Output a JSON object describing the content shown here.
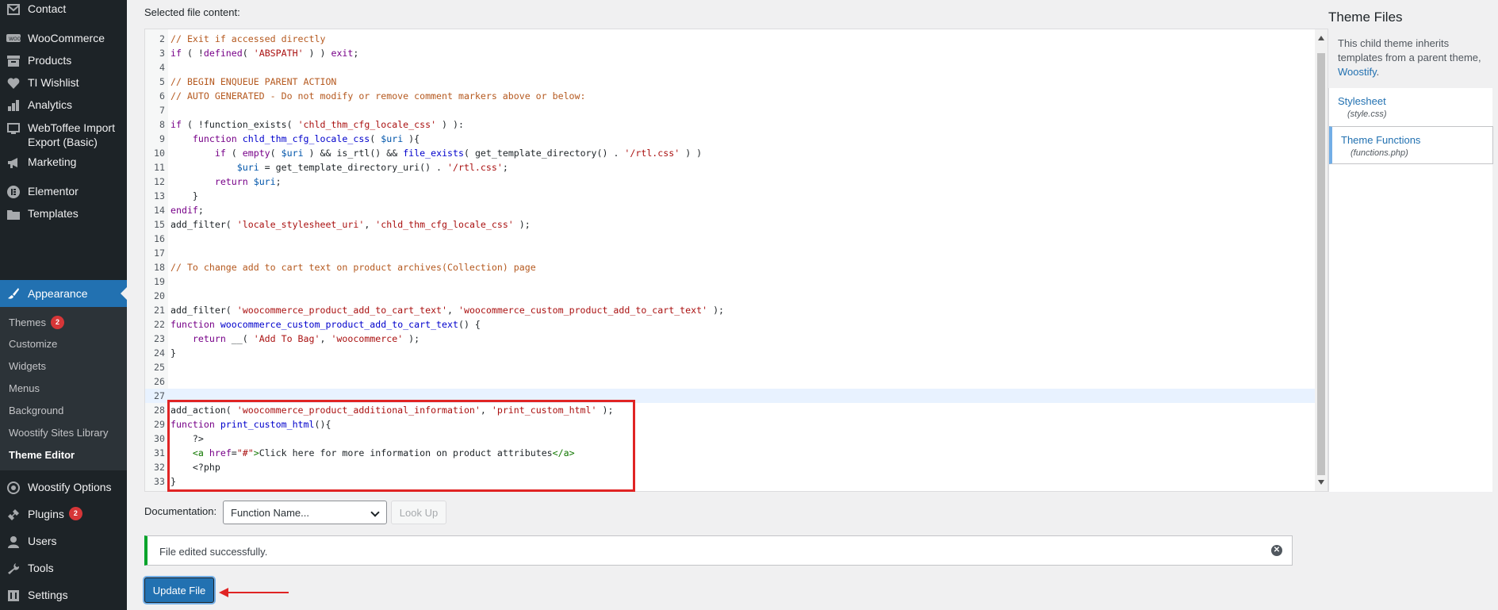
{
  "sidebar": {
    "menu": [
      {
        "label": "Contact",
        "icon": "mail-icon"
      },
      {
        "label": "WooCommerce",
        "icon": "woocommerce-icon"
      },
      {
        "label": "Products",
        "icon": "archive-icon"
      },
      {
        "label": "TI Wishlist",
        "icon": "heart-icon"
      },
      {
        "label": "Analytics",
        "icon": "bar-chart-icon"
      },
      {
        "label": "WebToffee Import Export (Basic)",
        "icon": "import-export-icon"
      },
      {
        "label": "Marketing",
        "icon": "megaphone-icon"
      },
      {
        "label": "Elementor",
        "icon": "elementor-icon"
      },
      {
        "label": "Templates",
        "icon": "folder-icon"
      },
      {
        "label": "Appearance",
        "icon": "paintbrush-icon"
      },
      {
        "label": "Woostify Options",
        "icon": "woostify-icon"
      },
      {
        "label": "Plugins",
        "icon": "plug-icon",
        "badge": "2"
      },
      {
        "label": "Users",
        "icon": "user-icon"
      },
      {
        "label": "Tools",
        "icon": "wrench-icon"
      },
      {
        "label": "Settings",
        "icon": "settings-icon"
      }
    ],
    "submenu": [
      {
        "label": "Themes",
        "badge": "2"
      },
      {
        "label": "Customize"
      },
      {
        "label": "Widgets"
      },
      {
        "label": "Menus"
      },
      {
        "label": "Background"
      },
      {
        "label": "Woostify Sites Library"
      },
      {
        "label": "Theme Editor"
      }
    ]
  },
  "editor": {
    "label": "Selected file content:",
    "lines": [
      {
        "n": "2",
        "tokens": [
          [
            "cm",
            "// Exit if accessed directly"
          ]
        ]
      },
      {
        "n": "3",
        "tokens": [
          [
            "kw",
            "if"
          ],
          [
            "",
            " ( !"
          ],
          [
            "kw",
            "defined"
          ],
          [
            "",
            "( "
          ],
          [
            "st",
            "'ABSPATH'"
          ],
          [
            "",
            " ) ) "
          ],
          [
            "kw",
            "exit"
          ],
          [
            "",
            ";"
          ]
        ]
      },
      {
        "n": "4",
        "tokens": []
      },
      {
        "n": "5",
        "tokens": [
          [
            "cm",
            "// BEGIN ENQUEUE PARENT ACTION"
          ]
        ]
      },
      {
        "n": "6",
        "tokens": [
          [
            "cm",
            "// AUTO GENERATED - Do not modify or remove comment markers above or below:"
          ]
        ]
      },
      {
        "n": "7",
        "tokens": []
      },
      {
        "n": "8",
        "tokens": [
          [
            "kw",
            "if"
          ],
          [
            "",
            " ( !function_exists( "
          ],
          [
            "st",
            "'chld_thm_cfg_locale_css'"
          ],
          [
            "",
            " ) ):"
          ]
        ]
      },
      {
        "n": "9",
        "tokens": [
          [
            "",
            "    "
          ],
          [
            "kw",
            "function"
          ],
          [
            "",
            " "
          ],
          [
            "fn",
            "chld_thm_cfg_locale_css"
          ],
          [
            "",
            "( "
          ],
          [
            "vr",
            "$uri"
          ],
          [
            "",
            " ){"
          ]
        ]
      },
      {
        "n": "10",
        "tokens": [
          [
            "",
            "        "
          ],
          [
            "kw",
            "if"
          ],
          [
            "",
            " ( "
          ],
          [
            "kw",
            "empty"
          ],
          [
            "",
            "( "
          ],
          [
            "vr",
            "$uri"
          ],
          [
            "",
            " ) && is_rtl() && "
          ],
          [
            "fn",
            "file_exists"
          ],
          [
            "",
            "( get_template_directory() . "
          ],
          [
            "st",
            "'/rtl.css'"
          ],
          [
            "",
            " ) )"
          ]
        ]
      },
      {
        "n": "11",
        "tokens": [
          [
            "",
            "            "
          ],
          [
            "vr",
            "$uri"
          ],
          [
            "",
            " = get_template_directory_uri() . "
          ],
          [
            "st",
            "'/rtl.css'"
          ],
          [
            "",
            ";"
          ]
        ]
      },
      {
        "n": "12",
        "tokens": [
          [
            "",
            "        "
          ],
          [
            "kw",
            "return"
          ],
          [
            "",
            " "
          ],
          [
            "vr",
            "$uri"
          ],
          [
            "",
            ";"
          ]
        ]
      },
      {
        "n": "13",
        "tokens": [
          [
            "",
            "    }"
          ]
        ]
      },
      {
        "n": "14",
        "tokens": [
          [
            "kw",
            "endif"
          ],
          [
            "",
            ";"
          ]
        ]
      },
      {
        "n": "15",
        "tokens": [
          [
            "",
            "add_filter( "
          ],
          [
            "st",
            "'locale_stylesheet_uri'"
          ],
          [
            "",
            ", "
          ],
          [
            "st",
            "'chld_thm_cfg_locale_css'"
          ],
          [
            "",
            " );"
          ]
        ]
      },
      {
        "n": "16",
        "tokens": []
      },
      {
        "n": "17",
        "tokens": []
      },
      {
        "n": "18",
        "tokens": [
          [
            "cm",
            "// To change add to cart text on product archives(Collection) page"
          ]
        ]
      },
      {
        "n": "19",
        "tokens": []
      },
      {
        "n": "20",
        "tokens": []
      },
      {
        "n": "21",
        "tokens": [
          [
            "",
            "add_filter( "
          ],
          [
            "st",
            "'woocommerce_product_add_to_cart_text'"
          ],
          [
            "",
            ", "
          ],
          [
            "st",
            "'woocommerce_custom_product_add_to_cart_text'"
          ],
          [
            "",
            " );"
          ]
        ]
      },
      {
        "n": "22",
        "tokens": [
          [
            "kw",
            "function"
          ],
          [
            "",
            " "
          ],
          [
            "fn",
            "woocommerce_custom_product_add_to_cart_text"
          ],
          [
            "",
            "() {"
          ]
        ]
      },
      {
        "n": "23",
        "tokens": [
          [
            "",
            "    "
          ],
          [
            "kw",
            "return"
          ],
          [
            "",
            " __( "
          ],
          [
            "st",
            "'Add To Bag'"
          ],
          [
            "",
            ", "
          ],
          [
            "st",
            "'woocommerce'"
          ],
          [
            "",
            " );"
          ]
        ]
      },
      {
        "n": "24",
        "tokens": [
          [
            "",
            "}"
          ]
        ]
      },
      {
        "n": "25",
        "tokens": []
      },
      {
        "n": "26",
        "tokens": []
      },
      {
        "n": "27",
        "tokens": [],
        "highlight": true
      },
      {
        "n": "28",
        "tokens": [
          [
            "",
            "add_action( "
          ],
          [
            "st",
            "'woocommerce_product_additional_information'"
          ],
          [
            "",
            ", "
          ],
          [
            "st",
            "'print_custom_html'"
          ],
          [
            "",
            " );"
          ]
        ]
      },
      {
        "n": "29",
        "tokens": [
          [
            "kw",
            "function"
          ],
          [
            "",
            " "
          ],
          [
            "fn",
            "print_custom_html"
          ],
          [
            "",
            "(){"
          ]
        ]
      },
      {
        "n": "30",
        "tokens": [
          [
            "",
            "    ?>"
          ]
        ]
      },
      {
        "n": "31",
        "tokens": [
          [
            "",
            "    "
          ],
          [
            "tg",
            "<a"
          ],
          [
            "",
            " "
          ],
          [
            "kw",
            "href"
          ],
          [
            "",
            "="
          ],
          [
            "st",
            "\"#\""
          ],
          [
            "tg",
            ">"
          ],
          [
            "",
            "Click here for more information on product attributes"
          ],
          [
            "tg",
            "</a>"
          ]
        ]
      },
      {
        "n": "32",
        "tokens": [
          [
            "",
            "    <?php"
          ]
        ]
      },
      {
        "n": "33",
        "tokens": [
          [
            "",
            "}"
          ]
        ]
      }
    ]
  },
  "theme_files": {
    "title": "Theme Files",
    "description_prefix": "This child theme inherits templates from a parent theme, ",
    "parent_theme": "Woostify",
    "description_suffix": ".",
    "files": [
      {
        "name": "Stylesheet",
        "file": "(style.css)"
      },
      {
        "name": "Theme Functions",
        "file": "(functions.php)"
      }
    ]
  },
  "documentation": {
    "label": "Documentation:",
    "select_value": "Function Name...",
    "lookup_label": "Look Up"
  },
  "notice": {
    "text": "File edited successfully."
  },
  "update_button": "Update File",
  "colors": {
    "accent": "#2271b1",
    "sidebar": "#1d2327",
    "success": "#00a32a",
    "annotation": "#e02424"
  }
}
